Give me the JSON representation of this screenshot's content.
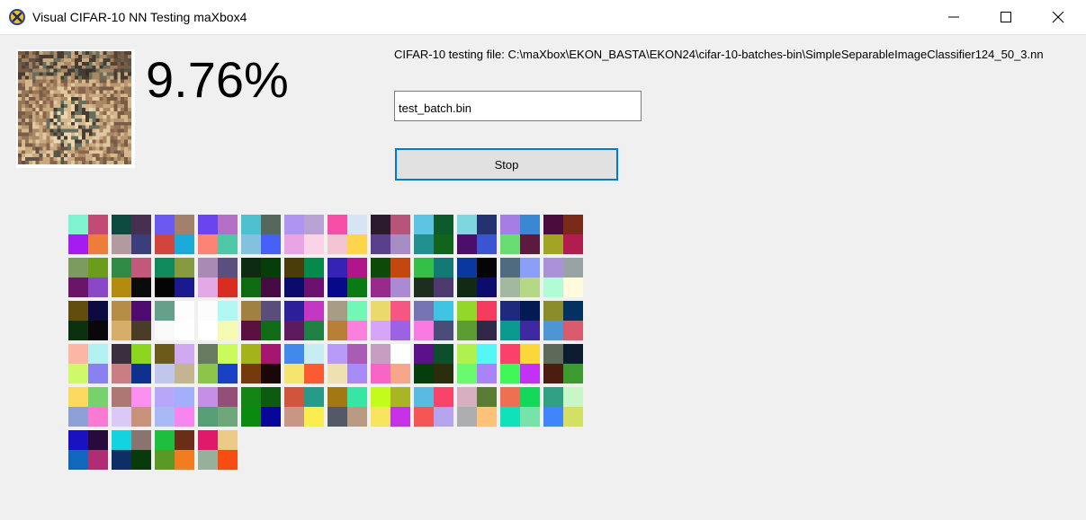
{
  "window": {
    "title": "Visual CIFAR-10 NN Testing maXbox4",
    "icon": "maxbox-x-icon",
    "controls": [
      "minimize-icon",
      "maximize-icon",
      "close-icon"
    ]
  },
  "result": {
    "accuracy": "9.76%",
    "thumbnail": "cifar-sample-image"
  },
  "file_info": {
    "label": "CIFAR-10 testing file: C:\\maXbox\\EKON_BASTA\\EKON24\\cifar-10-batches-bin\\SimpleSeparableImageClassifier124_50_3.nn"
  },
  "batch_field": {
    "value": "test_batch.bin"
  },
  "stop_button": {
    "label": "Stop"
  },
  "filters": {
    "columns": 12,
    "tiles": [
      [
        "#7ff3d0",
        "#c34a74",
        "#a41cf0",
        "#ee7c3c"
      ],
      [
        "#0f4a3f",
        "#47304f",
        "#b39a9e",
        "#3a3f7c"
      ],
      [
        "#6b59f2",
        "#a3806c",
        "#d2453d",
        "#1ba9d7"
      ],
      [
        "#6a44ef",
        "#b36fc5",
        "#fd8375",
        "#4dc7a6"
      ],
      [
        "#4dc1d0",
        "#56685b",
        "#83c2de",
        "#4660f5"
      ],
      [
        "#b094f1",
        "#b9a2d5",
        "#eba4e3",
        "#fbd3e6"
      ],
      [
        "#f64fa8",
        "#d7e4f4",
        "#f2c5d4",
        "#fdd54a"
      ],
      [
        "#2c1a2e",
        "#b6547a",
        "#5a3f8c",
        "#a78dc3"
      ],
      [
        "#5ec4e3",
        "#0d5a2d",
        "#21908f",
        "#10641c"
      ],
      [
        "#7ed6df",
        "#243370",
        "#4b0e6a",
        "#3b54d2"
      ],
      [
        "#a57de4",
        "#3a88d4",
        "#67dd72",
        "#5c1a3e"
      ],
      [
        "#4a0c3c",
        "#7b2a1a",
        "#a3a425",
        "#b11d4f"
      ],
      [
        "#7c9b5e",
        "#6b9d1b",
        "#6b1568",
        "#8a48c8"
      ],
      [
        "#2f8b46",
        "#c3597a",
        "#b48a0f",
        "#0c0b0c"
      ],
      [
        "#0f8a5c",
        "#869b40",
        "#040404",
        "#1a1a8e"
      ],
      [
        "#a98ab4",
        "#5a4f7e",
        "#e2a9e6",
        "#d92d22"
      ],
      [
        "#0c2b12",
        "#063d0a",
        "#0f6b12",
        "#470b44"
      ],
      [
        "#4b3d09",
        "#068a4b",
        "#0b0b6e",
        "#6d116e"
      ],
      [
        "#3423b5",
        "#b2158a",
        "#08088a",
        "#0a7a15"
      ],
      [
        "#0d4a0a",
        "#c3470f",
        "#972a8c",
        "#a98ad3"
      ],
      [
        "#33bf48",
        "#117a74",
        "#1d2e1e",
        "#4d3a6e"
      ],
      [
        "#0b389c",
        "#050505",
        "#102a13",
        "#0c0c6e"
      ],
      [
        "#4f6c7e",
        "#8b9ff8",
        "#a2b8a0",
        "#b5d887"
      ],
      [
        "#ab91d8",
        "#98a4a4",
        "#b0fcd4",
        "#fffbdc"
      ],
      [
        "#624d0e",
        "#0b0b42",
        "#0b310f",
        "#08080a"
      ],
      [
        "#b58d47",
        "#4e0a6e",
        "#d6ae6a",
        "#4a3c27"
      ],
      [
        "#67a08a",
        "#fdfdfd",
        "#f9f9f9",
        "#fefefe"
      ],
      [
        "#fcfcfc",
        "#b1f7f2",
        "#ffffff",
        "#f7fbb2"
      ],
      [
        "#a18142",
        "#594e7a",
        "#5b1140",
        "#126b17"
      ],
      [
        "#2c1f98",
        "#c337c4",
        "#5d1a5e",
        "#218043"
      ],
      [
        "#a99c86",
        "#72f7b6",
        "#b97f37",
        "#fb7fdc"
      ],
      [
        "#e9da6a",
        "#f55683",
        "#d7a5f7",
        "#9d61e4"
      ],
      [
        "#7474b2",
        "#3fc5e3",
        "#f97be1",
        "#4a4d7a"
      ],
      [
        "#94d72b",
        "#f53b60",
        "#5b9c33",
        "#2f2947"
      ],
      [
        "#1f2a7c",
        "#021b53",
        "#0b9a90",
        "#3d2aa0"
      ],
      [
        "#8b8d2b",
        "#033260",
        "#4d95d4",
        "#d85b6e"
      ],
      [
        "#fcb6a6",
        "#b2f0f4",
        "#d0f96a",
        "#8981f0"
      ],
      [
        "#3b2f3f",
        "#8dd620",
        "#c87e83",
        "#0d318d"
      ],
      [
        "#6c5a1a",
        "#cfaaf0",
        "#c1c6ec",
        "#c3b592"
      ],
      [
        "#687a5f",
        "#cbfb5a",
        "#8cc54a",
        "#1a40c3"
      ],
      [
        "#a5b31a",
        "#a51670",
        "#743a0b",
        "#1c0708"
      ],
      [
        "#4289ec",
        "#c6eef2",
        "#f5e46f",
        "#fc5a33"
      ],
      [
        "#b89bf8",
        "#a85cb3",
        "#ede0b1",
        "#a88bf7"
      ],
      [
        "#c79dc2",
        "#fefefe",
        "#f865c7",
        "#f8a68a"
      ],
      [
        "#5c108a",
        "#0d4f2b",
        "#053d0c",
        "#2a2e0d"
      ],
      [
        "#b0f14f",
        "#55f7f6",
        "#6afa6f",
        "#a984f8"
      ],
      [
        "#fb416b",
        "#fcd73b",
        "#41f659",
        "#c331f6"
      ],
      [
        "#5d6a5a",
        "#0d1d2f",
        "#4c1c10",
        "#3c9a30"
      ],
      [
        "#fbd95c",
        "#77d26e",
        "#8da1d6",
        "#f97ad0"
      ],
      [
        "#ad7874",
        "#fb8ff0",
        "#dac8f7",
        "#c8917a"
      ],
      [
        "#b8a7f8",
        "#a2b0fb",
        "#a8b9f5",
        "#f685f0"
      ],
      [
        "#c58ee7",
        "#944f78",
        "#579e76",
        "#6fa77d"
      ],
      [
        "#138514",
        "#0c5b0f",
        "#098b12",
        "#06069b"
      ],
      [
        "#d0553c",
        "#269b8c",
        "#c99686",
        "#f8ec4e"
      ],
      [
        "#a47810",
        "#37e6a4",
        "#555867",
        "#b99a83"
      ],
      [
        "#c3fb1b",
        "#a8b524",
        "#f7e560",
        "#c431e7"
      ],
      [
        "#59bbe1",
        "#fa436b",
        "#f65555",
        "#b6a3ee"
      ],
      [
        "#d7afc1",
        "#597b33",
        "#adaeb0",
        "#fec27a"
      ],
      [
        "#ee6f51",
        "#12d95a",
        "#0fe2b8",
        "#78e3a8"
      ],
      [
        "#319f82",
        "#c6f7c4",
        "#4185fb",
        "#d3e063"
      ],
      [
        "#1a12c1",
        "#280a3c",
        "#1167bd",
        "#b12c73"
      ],
      [
        "#13d3e0",
        "#8a7470",
        "#0e2e66",
        "#083a0a"
      ],
      [
        "#1ebe3f",
        "#6a2e16",
        "#5a9a24",
        "#f27c1f"
      ],
      [
        "#e0196b",
        "#ebc986",
        "#97b09c",
        "#f74d13"
      ]
    ]
  }
}
